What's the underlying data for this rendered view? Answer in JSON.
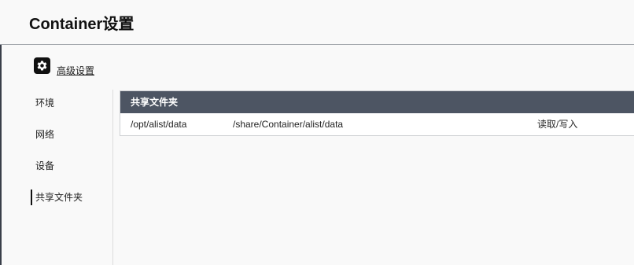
{
  "window": {
    "title": "Container设置"
  },
  "advanced": {
    "icon": "gear-icon",
    "label": "高级设置"
  },
  "sidebar": {
    "items": [
      {
        "label": "环境",
        "active": false
      },
      {
        "label": "网络",
        "active": false
      },
      {
        "label": "设备",
        "active": false
      },
      {
        "label": "共享文件夹",
        "active": true
      }
    ]
  },
  "shared_folders": {
    "header": "共享文件夹",
    "rows": [
      {
        "container_path": "/opt/alist/data",
        "host_path": "/share/Container/alist/data",
        "permission": "读取/写入"
      }
    ]
  },
  "colors": {
    "table_header_bg": "#4d5563",
    "background": "#f9f9f9"
  }
}
